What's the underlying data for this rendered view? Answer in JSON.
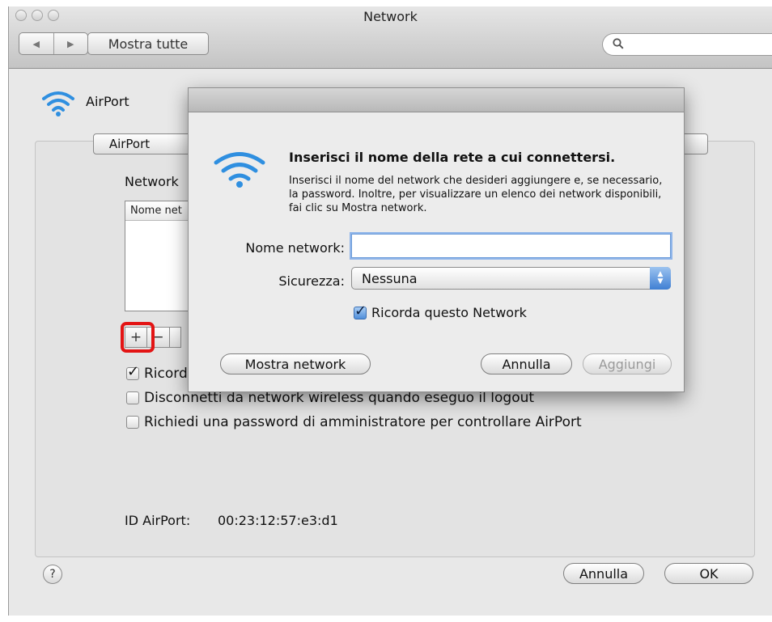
{
  "window": {
    "title": "Network",
    "show_all_label": "Mostra tutte"
  },
  "panel": {
    "header_label": "AirPort",
    "tab_label": "AirPort",
    "network_label": "Network",
    "table_header": "Nome net",
    "plus_label": "+",
    "minus_label": "−",
    "checkboxes": [
      {
        "label": "Ricord",
        "checked": true
      },
      {
        "label": "Disconnetti da network wireless quando eseguo il logout",
        "checked": false
      },
      {
        "label": "Richiedi una password di amministratore per controllare AirPort",
        "checked": false
      }
    ],
    "id_label": "ID AirPort:",
    "id_value": "00:23:12:57:e3:d1"
  },
  "footer": {
    "help_label": "?",
    "cancel_label": "Annulla",
    "ok_label": "OK"
  },
  "dialog": {
    "title": "Inserisci il nome della rete a cui connettersi.",
    "description": "Inserisci il nome del network che desideri aggiungere e, se necessario, la password. Inoltre, per visualizzare un elenco dei network disponibili, fai clic su Mostra network.",
    "network_name_label": "Nome network:",
    "network_name_value": "",
    "security_label": "Sicurezza:",
    "security_value": "Nessuna",
    "remember_label": "Ricorda questo Network",
    "remember_checked": true,
    "show_networks_label": "Mostra network",
    "cancel_label": "Annulla",
    "add_label": "Aggiungi"
  },
  "colors": {
    "highlight": "#e31414",
    "wifi_blue": "#2f8fe0"
  }
}
